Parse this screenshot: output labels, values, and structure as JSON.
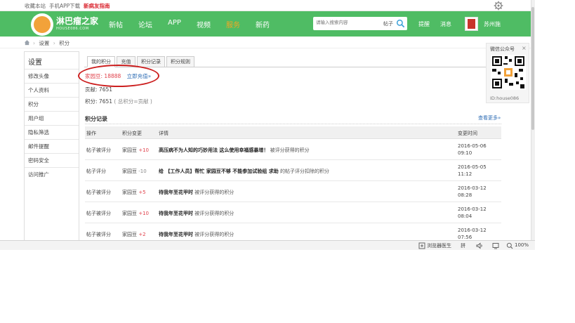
{
  "topbar": {
    "bookmark": "收藏本站",
    "app_download": "手机APP下载",
    "guide": "新病友指南",
    "settings_icon": "gear-icon"
  },
  "brand": {
    "name": "淋巴瘤之家",
    "sub": "HOUSE086.COM",
    "color": "#4fbc64"
  },
  "nav": {
    "items": [
      "新帖",
      "论坛",
      "APP",
      "视频",
      "服务",
      "新药"
    ],
    "active_index": 4,
    "active_color": "#f5a623",
    "search_placeholder": "请输入搜索内容",
    "search_type": "帖子",
    "remind": "提醒",
    "message": "消息",
    "username": "苏州施"
  },
  "breadcrumb": {
    "items": [
      "设置",
      "积分"
    ]
  },
  "sidebar": {
    "title": "设置",
    "items": [
      "修改头像",
      "个人资料",
      "积分",
      "用户组",
      "隐私筛选",
      "邮件提醒",
      "密码安全",
      "访问推广"
    ],
    "active_index": 2
  },
  "tabs": [
    "我的积分",
    "充值",
    "积分记录",
    "积分规则"
  ],
  "credits": {
    "label": "家园豆:",
    "value": "18888",
    "recharge": "立即充值»",
    "contribution_label": "贡献:",
    "contribution_value": "7651",
    "points_label": "积分:",
    "points_value": "7651",
    "points_note": "( 总积分=贡献 )"
  },
  "records": {
    "title": "积分记录",
    "more": "查看更多»",
    "headers": [
      "操作",
      "积分变更",
      "详情",
      "变更时间"
    ],
    "rows": [
      {
        "op": "帖子被评分",
        "currency": "家园豆",
        "delta": "+10",
        "title": "高压病不为人知的巧妙用法 这么使用幸福感暴增！",
        "desc": "被评分获得的积分",
        "date": "2016-05-06",
        "time": "09:10"
      },
      {
        "op": "帖子评分",
        "currency": "家园豆",
        "delta": "-10",
        "title": "给 【工作人员】帮忙 家园豆不够 不能参加试验组 求助",
        "desc": "的帖子评分扣除的积分",
        "date": "2016-05-05",
        "time": "11:12"
      },
      {
        "op": "帖子被评分",
        "currency": "家园豆",
        "delta": "+5",
        "title": "待我年至花甲时",
        "desc": "被评分获得的积分",
        "date": "2016-03-12",
        "time": "08:28"
      },
      {
        "op": "帖子被评分",
        "currency": "家园豆",
        "delta": "+10",
        "title": "待我年至花甲时",
        "desc": "被评分获得的积分",
        "date": "2016-03-12",
        "time": "08:04"
      },
      {
        "op": "帖子被评分",
        "currency": "家园豆",
        "delta": "+2",
        "title": "待我年至花甲时",
        "desc": "被评分获得的积分",
        "date": "2016-03-12",
        "time": "07:56"
      }
    ]
  },
  "wechat": {
    "title": "微信公众号",
    "close": "×",
    "id": "ID:house086"
  },
  "statusbar": {
    "browser_doctor": "浏览器医生",
    "ime": "拼",
    "zoom": "100%"
  }
}
